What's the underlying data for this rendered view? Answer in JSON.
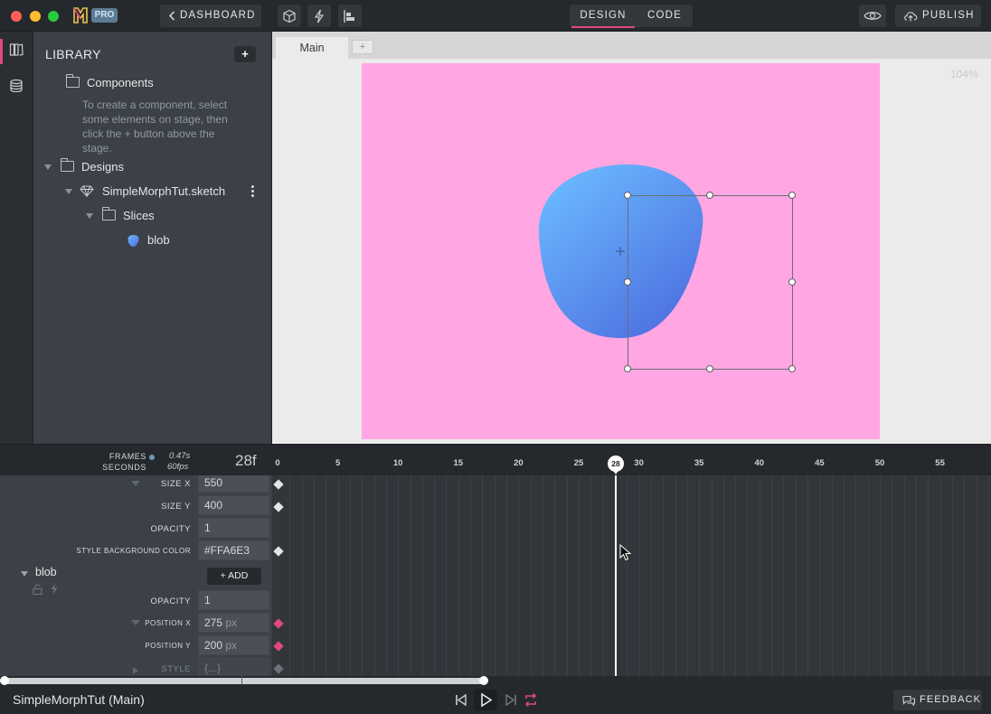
{
  "app": {
    "badge": "PRO",
    "dashboard_label": "DASHBOARD",
    "modes": {
      "design": "DESIGN",
      "code": "CODE",
      "active": "design"
    },
    "publish_label": "PUBLISH",
    "accent_color": "#e0497f"
  },
  "library": {
    "title": "LIBRARY",
    "add_label": "+",
    "tree": {
      "components": "Components",
      "components_hint": "To create a component, select some elements on stage, then click the + button above the stage.",
      "designs": "Designs",
      "sketch_file": "SimpleMorphTut.sketch",
      "slices": "Slices",
      "blob": "blob"
    }
  },
  "stage": {
    "tab": "Main",
    "add_tab": "+",
    "zoom": "104%",
    "artboard_color": "#ffa6e3",
    "blob_gradient": [
      "#6ab8ff",
      "#4d6fe0"
    ]
  },
  "timeline": {
    "frames_label": "FRAMES",
    "seconds_label": "SECONDS",
    "seconds_value": "0.47s",
    "fps_value": "60fps",
    "current_frame_display": "28f",
    "playhead_frame": "28",
    "ruler": [
      "0",
      "5",
      "10",
      "15",
      "20",
      "25",
      "30",
      "35",
      "40",
      "45",
      "50",
      "55"
    ],
    "properties": {
      "size_x": {
        "label": "SIZE X",
        "value": "550"
      },
      "size_y": {
        "label": "SIZE Y",
        "value": "400"
      },
      "opacity": {
        "label": "OPACITY",
        "value": "1"
      },
      "style_bg": {
        "label": "STYLE BACKGROUND COLOR",
        "value": "#FFA6E3"
      }
    },
    "layer": {
      "name": "blob",
      "add_label": "+ ADD",
      "opacity": {
        "label": "OPACITY",
        "value": "1"
      },
      "position_x": {
        "label": "POSITION X",
        "value": "275",
        "unit": "px"
      },
      "position_y": {
        "label": "POSITION Y",
        "value": "200",
        "unit": "px"
      },
      "style": {
        "label": "STYLE",
        "value": "{...}"
      }
    }
  },
  "footer": {
    "project_name": "SimpleMorphTut (Main)",
    "feedback_label": "FEEDBACK"
  }
}
